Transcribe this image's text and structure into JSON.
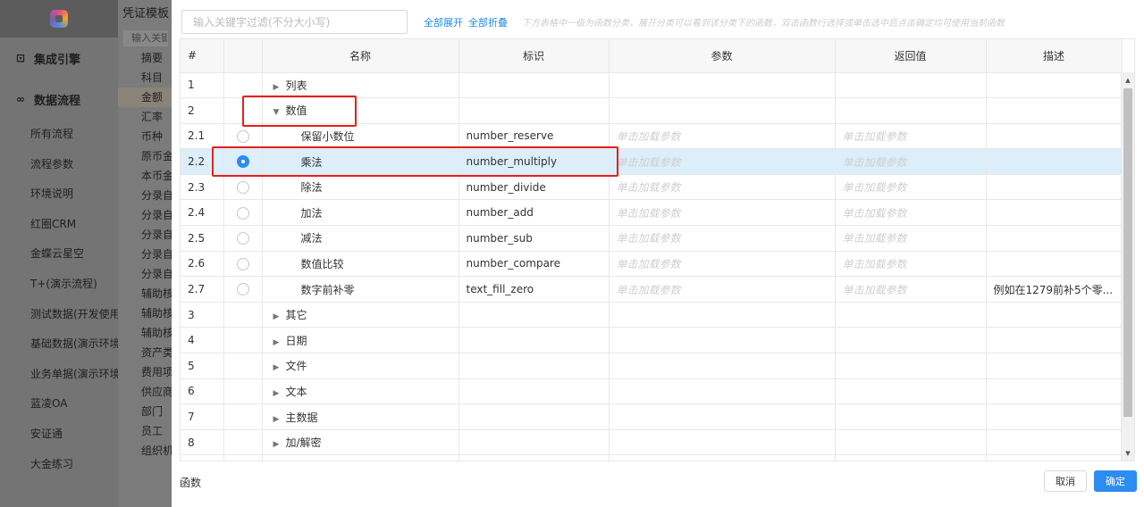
{
  "sidebar": {
    "sections": [
      {
        "icon": "⊡",
        "label": "集成引擎"
      },
      {
        "icon": "∞",
        "label": "数据流程"
      }
    ],
    "items": [
      "所有流程",
      "流程参数",
      "环境说明",
      "红圈CRM",
      "金蝶云星空",
      "T+(演示流程)",
      "测试数据(开发使用",
      "基础数据(演示环境",
      "业务单据(演示环境",
      "蓝凌OA",
      "安证通",
      "大金练习"
    ]
  },
  "mid_panel": {
    "title": "凭证模板",
    "search_placeholder": "输入关键",
    "items": [
      "摘要",
      "科目",
      "金额",
      "汇率",
      "币种",
      "原币金",
      "本币金",
      "分录自",
      "分录自",
      "分录自",
      "分录自",
      "分录自",
      "辅助核",
      "辅助核",
      "辅助核",
      "资产类",
      "费用项",
      "供应商",
      "部门",
      "员工",
      "组织机"
    ],
    "active_index": 2
  },
  "dialog": {
    "filter_placeholder": "输入关键字过滤(不分大小写)",
    "expand_all": "全部展开",
    "collapse_all": "全部折叠",
    "hint": "下方表格中一级为函数分类，展开分类可以看到该分类下的函数，双击函数行选择或单击选中后点击确定均可使用当前函数",
    "columns": {
      "num": "#",
      "name": "名称",
      "id": "标识",
      "param": "参数",
      "ret": "返回值",
      "desc": "描述"
    },
    "rows": [
      {
        "num": "1",
        "type": "category",
        "expanded": false,
        "name": "列表"
      },
      {
        "num": "2",
        "type": "category",
        "expanded": true,
        "name": "数值"
      },
      {
        "num": "2.1",
        "type": "function",
        "name": "保留小数位",
        "id": "number_reserve",
        "param": "单击加载参数",
        "ret": "单击加载参数",
        "desc": "",
        "checked": false
      },
      {
        "num": "2.2",
        "type": "function",
        "name": "乘法",
        "id": "number_multiply",
        "param": "单击加载参数",
        "ret": "单击加载参数",
        "desc": "",
        "checked": true
      },
      {
        "num": "2.3",
        "type": "function",
        "name": "除法",
        "id": "number_divide",
        "param": "单击加载参数",
        "ret": "单击加载参数",
        "desc": "",
        "checked": false
      },
      {
        "num": "2.4",
        "type": "function",
        "name": "加法",
        "id": "number_add",
        "param": "单击加载参数",
        "ret": "单击加载参数",
        "desc": "",
        "checked": false
      },
      {
        "num": "2.5",
        "type": "function",
        "name": "减法",
        "id": "number_sub",
        "param": "单击加载参数",
        "ret": "单击加载参数",
        "desc": "",
        "checked": false
      },
      {
        "num": "2.6",
        "type": "function",
        "name": "数值比较",
        "id": "number_compare",
        "param": "单击加载参数",
        "ret": "单击加载参数",
        "desc": "",
        "checked": false
      },
      {
        "num": "2.7",
        "type": "function",
        "name": "数字前补零",
        "id": "text_fill_zero",
        "param": "单击加载参数",
        "ret": "单击加载参数",
        "desc": "例如在1279前补5个零...",
        "checked": false
      },
      {
        "num": "3",
        "type": "category",
        "expanded": false,
        "name": "其它"
      },
      {
        "num": "4",
        "type": "category",
        "expanded": false,
        "name": "日期"
      },
      {
        "num": "5",
        "type": "category",
        "expanded": false,
        "name": "文件"
      },
      {
        "num": "6",
        "type": "category",
        "expanded": false,
        "name": "文本"
      },
      {
        "num": "7",
        "type": "category",
        "expanded": false,
        "name": "主数据"
      },
      {
        "num": "8",
        "type": "category",
        "expanded": false,
        "name": "加/解密"
      },
      {
        "num": "",
        "type": "category",
        "expanded": false,
        "name": ""
      }
    ],
    "footer_label": "函数",
    "cancel_label": "取消",
    "ok_label": "确定",
    "colors": {
      "accent": "#2d8cf0",
      "highlight_border": "#e22020",
      "selected_row": "#dbeefa"
    }
  }
}
